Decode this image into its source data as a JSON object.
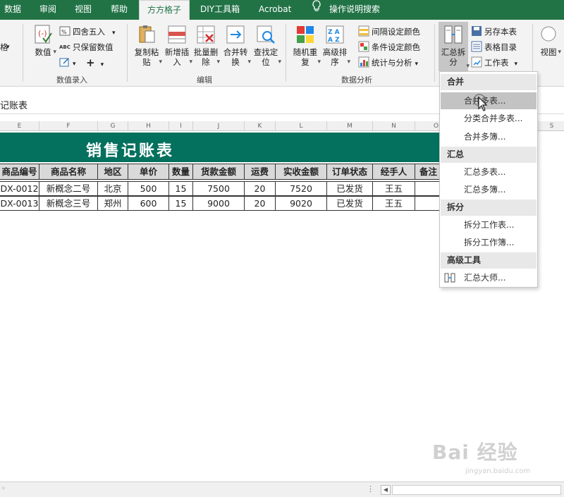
{
  "tabs": [
    "数据",
    "审阅",
    "视图",
    "帮助",
    "方方格子",
    "DIY工具箱",
    "Acrobat",
    "操作说明搜索"
  ],
  "ribbon": {
    "value_entry": {
      "partial_label": "格",
      "value_btn": "数值",
      "round_btn": "四舍五入",
      "keep_value_btn": "只保留数值",
      "group_label": "数值录入"
    },
    "edit": {
      "copy_paste": [
        "复制粘",
        "贴"
      ],
      "add_insert": [
        "新增插",
        "入"
      ],
      "batch_delete": [
        "批量删",
        "除"
      ],
      "merge_convert": [
        "合并转",
        "换"
      ],
      "find_locate": [
        "查找定",
        "位"
      ],
      "group_label": "编辑"
    },
    "data_analysis": {
      "random_repeat": [
        "随机重",
        "复"
      ],
      "adv_sort": [
        "高级排",
        "序"
      ],
      "interval_color": "间隔设定颜色",
      "cond_color": "条件设定颜色",
      "stats_analysis": "统计与分析",
      "group_label": "数据分析"
    },
    "summary": {
      "split_btn": [
        "汇总拆",
        "分"
      ],
      "save_sheet": "另存本表",
      "sheet_dir": "表格目录",
      "worksheet": "工作表"
    },
    "view": {
      "view_btn": "视图"
    }
  },
  "namebox": {
    "text": "记账表"
  },
  "columns": [
    "E",
    "F",
    "G",
    "H",
    "I",
    "J",
    "K",
    "L",
    "M",
    "N",
    "O",
    "S"
  ],
  "sheet": {
    "title": "销售记账表",
    "headers": [
      "商品编号",
      "商品名称",
      "地区",
      "单价",
      "数量",
      "货款金额",
      "运费",
      "实收金额",
      "订单状态",
      "经手人",
      "备注"
    ],
    "rows": [
      [
        "DX-0012",
        "新概念二号",
        "北京",
        "500",
        "15",
        "7500",
        "20",
        "7520",
        "已发货",
        "王五",
        ""
      ],
      [
        "DX-0013",
        "新概念三号",
        "郑州",
        "600",
        "15",
        "9000",
        "20",
        "9020",
        "已发货",
        "王五",
        ""
      ]
    ]
  },
  "dropdown": {
    "sections": [
      {
        "title": "合并",
        "items": [
          "合并多表...",
          "分类合并多表...",
          "合并多簿..."
        ]
      },
      {
        "title": "汇总",
        "items": [
          "汇总多表...",
          "汇总多簿..."
        ]
      },
      {
        "title": "拆分",
        "items": [
          "拆分工作表...",
          "拆分工作簿..."
        ]
      },
      {
        "title": "高级工具",
        "items": [
          "汇总大师..."
        ]
      }
    ]
  },
  "watermark": {
    "brand": "Bai 经验",
    "url": "jingyan.baidu.com"
  },
  "colors": {
    "excel_green": "#217346",
    "title_green": "#04705e",
    "header_gray": "#d9d9d9",
    "menu_highlight": "#c3c3c3"
  }
}
